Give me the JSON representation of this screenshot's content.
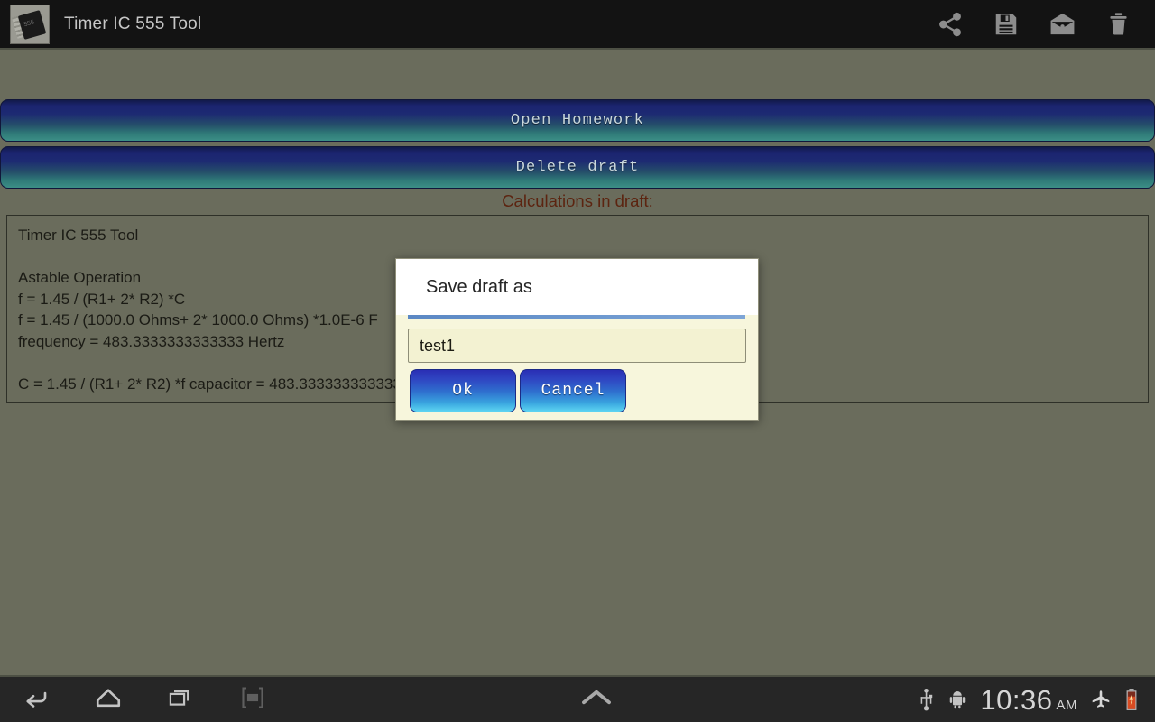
{
  "actionbar": {
    "title": "Timer IC 555 Tool",
    "app_icon_name": "app-icon-555-chip",
    "actions": [
      {
        "name": "share-icon",
        "label": "Share"
      },
      {
        "name": "save-icon",
        "label": "Save"
      },
      {
        "name": "open-mail-icon",
        "label": "Open"
      },
      {
        "name": "trash-icon",
        "label": "Delete"
      }
    ]
  },
  "buttons": {
    "open_homework": "Open Homework",
    "delete_draft": "Delete draft"
  },
  "draft": {
    "label": "Calculations in draft:",
    "lines": [
      "Timer IC 555 Tool",
      "",
      "Astable Operation",
      "f = 1.45 / (R1+ 2* R2) *C",
      "f = 1.45 / (1000.0 Ohms+ 2* 1000.0 Ohms) *1.0E-6 F",
      "frequency = 483.3333333333333 Hertz",
      "",
      "C = 1.45 / (R1+ 2* R2) *f capacitor = 483.3333333333333"
    ]
  },
  "dialog": {
    "title": "Save draft as",
    "input_value": "test1",
    "input_placeholder": "",
    "ok_label": "Ok",
    "cancel_label": "Cancel"
  },
  "sysbar": {
    "nav": [
      {
        "name": "back-icon",
        "label": "Back"
      },
      {
        "name": "home-icon",
        "label": "Home"
      },
      {
        "name": "recent-apps-icon",
        "label": "Recent apps"
      },
      {
        "name": "screenshot-icon",
        "label": "Screenshot"
      }
    ],
    "chevron_up_name": "chevron-up-icon",
    "status": {
      "usb_icon": "usb-icon",
      "android_icon": "android-robot-icon",
      "time": "10:36",
      "ampm": "AM",
      "airplane_icon": "airplane-mode-icon",
      "battery_icon": "battery-charging-icon"
    }
  },
  "colors": {
    "background": "#6a6c5c",
    "actionbar": "#131313",
    "draft_label": "#5c2410",
    "button_gradient_top": "#1b2470",
    "button_gradient_bottom": "#3c8f86",
    "dialog_body": "#f7f6dc",
    "dialog_divider": "#6f9ad0",
    "dialog_button_top": "#2a2fb4",
    "dialog_button_bottom": "#5ed4f2"
  }
}
